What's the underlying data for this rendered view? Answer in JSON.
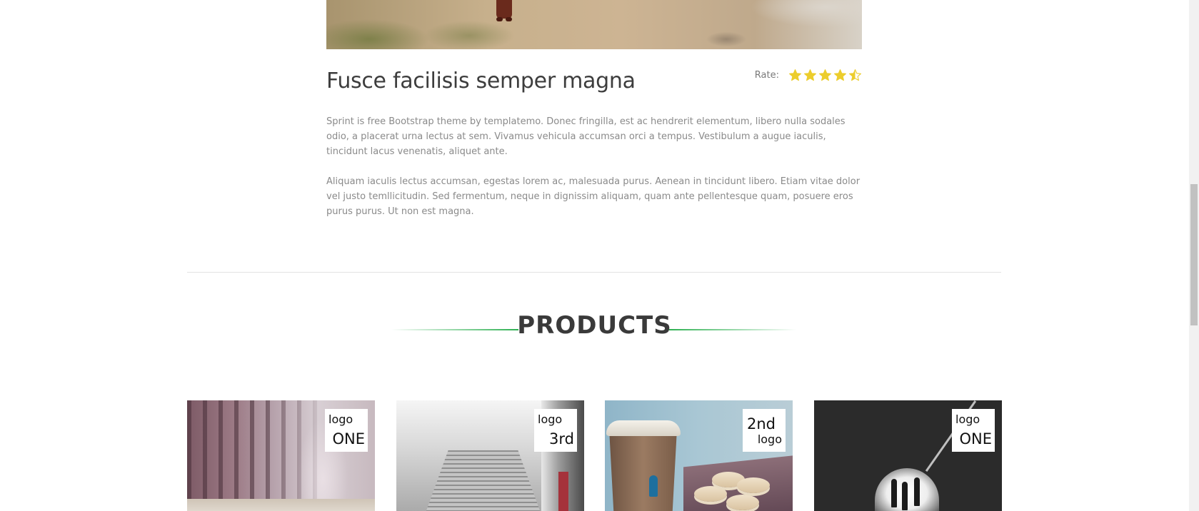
{
  "article": {
    "title": "Fusce facilisis semper magna",
    "rating_label": "Rate:",
    "rating": {
      "value": 4.5,
      "max": 5,
      "star_color": "#eccd2c"
    },
    "paragraphs": [
      "Sprint is free Bootstrap theme by templatemo. Donec fringilla, est ac hendrerit elementum, libero nulla sodales odio, a placerat urna lectus at sem. Vivamus vehicula accumsan orci a tempus. Vestibulum a augue iaculis, tincidunt lacus venenatis, aliquet ante.",
      "Aliquam iaculis lectus accumsan, egestas lorem ac, malesuada purus. Aenean in tincidunt libero. Etiam vitae dolor vel justo temllicitudin. Sed fermentum, neque in dignissim aliquam, quam ante pellentesque quam, posuere eros purus purus. Ut non est magna."
    ]
  },
  "products": {
    "heading": "PRODUCTS",
    "accent_color": "#2eb052",
    "items": [
      {
        "image": "misty-forest-road",
        "logo_small": "logo",
        "logo_big": "ONE"
      },
      {
        "image": "foggy-stairs",
        "logo_small": "logo",
        "logo_big": "3rd"
      },
      {
        "image": "coffee-cup-macarons",
        "logo_big": "2nd",
        "logo_small": "logo"
      },
      {
        "image": "tunnel-silhouettes",
        "logo_small": "logo",
        "logo_big": "ONE"
      }
    ]
  }
}
